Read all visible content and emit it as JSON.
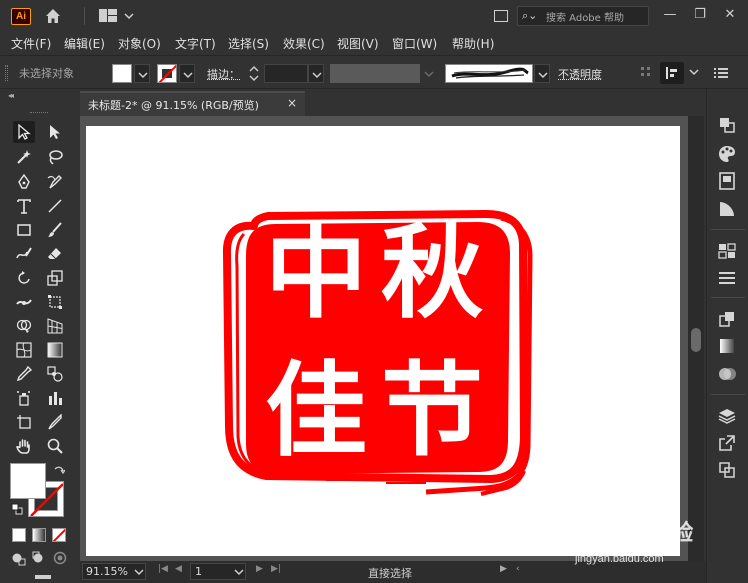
{
  "app": {
    "logo": "Ai"
  },
  "search": {
    "placeholder": "搜索 Adobe 帮助",
    "icon": "search-icon"
  },
  "menu": [
    "文件(F)",
    "编辑(E)",
    "对象(O)",
    "文字(T)",
    "选择(S)",
    "效果(C)",
    "视图(V)",
    "窗口(W)",
    "帮助(H)"
  ],
  "control": {
    "selection_status": "未选择对象",
    "stroke_label": "描边：",
    "opacity_label": "不透明度",
    "fill_color": "#ffffff"
  },
  "document": {
    "tab_title": "未标题-2* @ 91.15% (RGB/预览)",
    "close_glyph": "×"
  },
  "artwork": {
    "type": "seal-stamp",
    "color": "#ff0000",
    "chars": [
      "中",
      "秋",
      "佳",
      "节"
    ]
  },
  "status": {
    "zoom": "91.15%",
    "page": "1",
    "tool_name": "直接选择"
  },
  "watermark": {
    "main": "Baidu 经验",
    "sub": "jingyan.baidu.com"
  },
  "colors": {
    "chrome": "#323232",
    "canvas": "#535353",
    "accent_red": "#ff0000"
  }
}
